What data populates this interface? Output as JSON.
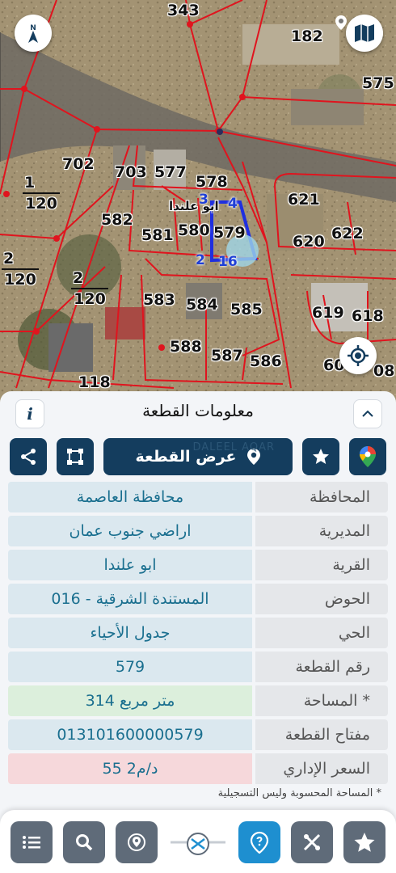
{
  "map": {
    "parcels": [
      {
        "id": "p343",
        "text": "343"
      },
      {
        "id": "p182",
        "text": "182"
      },
      {
        "id": "p575",
        "text": "575"
      },
      {
        "id": "p702",
        "text": "702"
      },
      {
        "id": "p703",
        "text": "703"
      },
      {
        "id": "p577",
        "text": "577"
      },
      {
        "id": "p578",
        "text": "578"
      },
      {
        "id": "p621",
        "text": "621"
      },
      {
        "id": "p582",
        "text": "582"
      },
      {
        "id": "p581",
        "text": "581"
      },
      {
        "id": "p580",
        "text": "580"
      },
      {
        "id": "p579",
        "text": "579"
      },
      {
        "id": "p620",
        "text": "620"
      },
      {
        "id": "p622",
        "text": "622"
      },
      {
        "id": "p583",
        "text": "583"
      },
      {
        "id": "p584",
        "text": "584"
      },
      {
        "id": "p585",
        "text": "585"
      },
      {
        "id": "p619",
        "text": "619"
      },
      {
        "id": "p618",
        "text": "618"
      },
      {
        "id": "p588",
        "text": "588"
      },
      {
        "id": "p587",
        "text": "587"
      },
      {
        "id": "p586",
        "text": "586"
      },
      {
        "id": "p60",
        "text": "60"
      },
      {
        "id": "p08",
        "text": "08"
      },
      {
        "id": "p118",
        "text": "118"
      }
    ],
    "fractions": [
      {
        "top": "1",
        "bottom": "120"
      },
      {
        "top": "2",
        "bottom": "120"
      },
      {
        "top": "2",
        "bottom": "120"
      }
    ],
    "corners": [
      "3",
      "4",
      "2",
      "16"
    ],
    "area_label": "ابو علندا",
    "compass_icon": "compass-north-icon",
    "map_icon": "folded-map-icon",
    "locate_icon": "crosshair-locate-icon"
  },
  "sheet": {
    "title": "معلومات القطعة",
    "info_icon": "i",
    "show_parcel_label": "عرض القطعة",
    "watermark": "DALEEL AQAR",
    "rows": [
      {
        "key": "المحافظة",
        "value": "محافظة العاصمة",
        "tone": "normal"
      },
      {
        "key": "المديرية",
        "value": "اراضي جنوب عمان",
        "tone": "normal"
      },
      {
        "key": "القرية",
        "value": "ابو علندا",
        "tone": "normal"
      },
      {
        "key": "الحوض",
        "value": "المستندة الشرقية - 016",
        "tone": "normal"
      },
      {
        "key": "الحي",
        "value": "جدول الأحياء",
        "tone": "normal"
      },
      {
        "key": "رقم القطعة",
        "value": "579",
        "tone": "normal"
      },
      {
        "key": "المساحة *",
        "value": "314  متر مربع",
        "tone": "green"
      },
      {
        "key": "مفتاح القطعة",
        "value": "013101600000579",
        "tone": "normal"
      },
      {
        "key": "السعر الإداري",
        "value": "55 د/م2",
        "tone": "red"
      }
    ],
    "note": "* المساحة المحسوبة وليس التسجيلية"
  },
  "colors": {
    "primary": "#143d5e",
    "accent": "#1e8fd0",
    "parcel_line": "#e0141e",
    "selected_parcel": "#1f2fe0"
  }
}
